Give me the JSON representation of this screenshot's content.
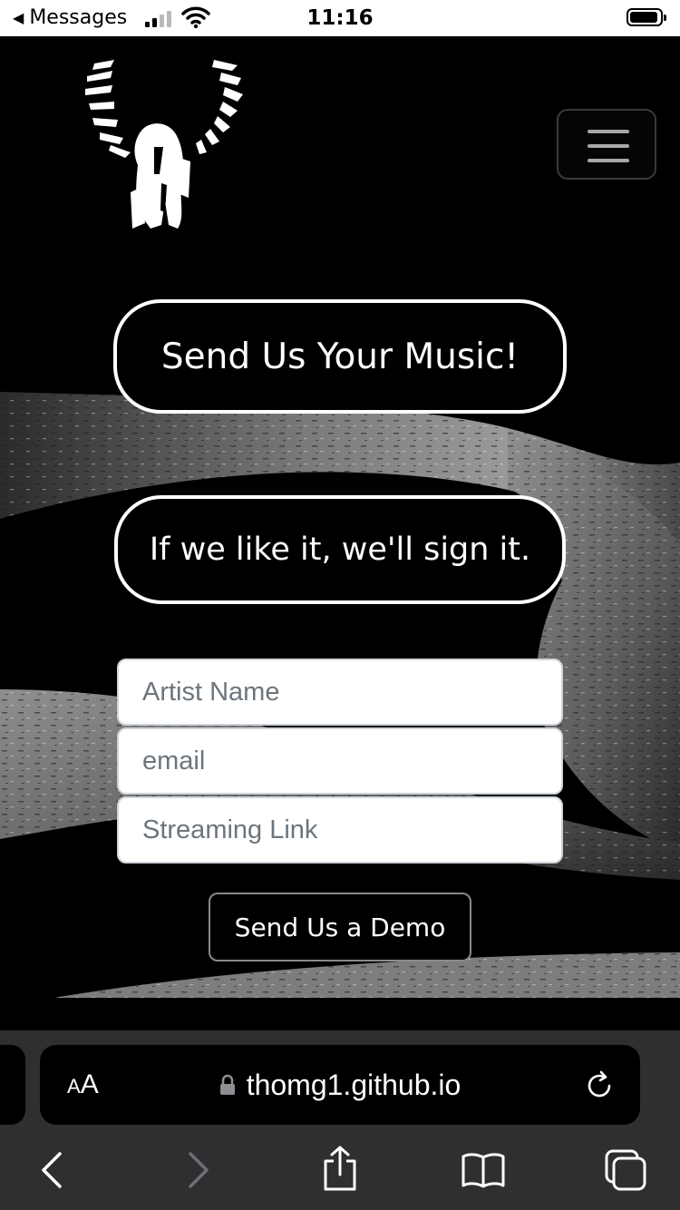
{
  "status_bar": {
    "back_label": "Messages",
    "time": "11:16"
  },
  "header": {
    "logo_icon": "winged-figure-logo",
    "menu_icon": "hamburger-icon"
  },
  "hero": {
    "headline": "Send Us Your Music!",
    "subline": "If we like it, we'll sign it."
  },
  "form": {
    "artist_name_placeholder": "Artist Name",
    "email_placeholder": "email",
    "streaming_link_placeholder": "Streaming Link",
    "submit_label": "Send Us a Demo"
  },
  "browser": {
    "text_size_label_small": "A",
    "text_size_label_big": "A",
    "url": "thomg1.github.io",
    "lock_icon": "lock-icon",
    "reload_icon": "reload-icon",
    "toolbar_icons": [
      "back-icon",
      "forward-icon",
      "share-icon",
      "bookmarks-icon",
      "tabs-icon"
    ]
  },
  "colors": {
    "page_background": "#000000",
    "pill_border": "#ffffff",
    "input_border": "#ced4da",
    "placeholder": "#6c757d",
    "browser_chrome": "#2f2f31"
  }
}
